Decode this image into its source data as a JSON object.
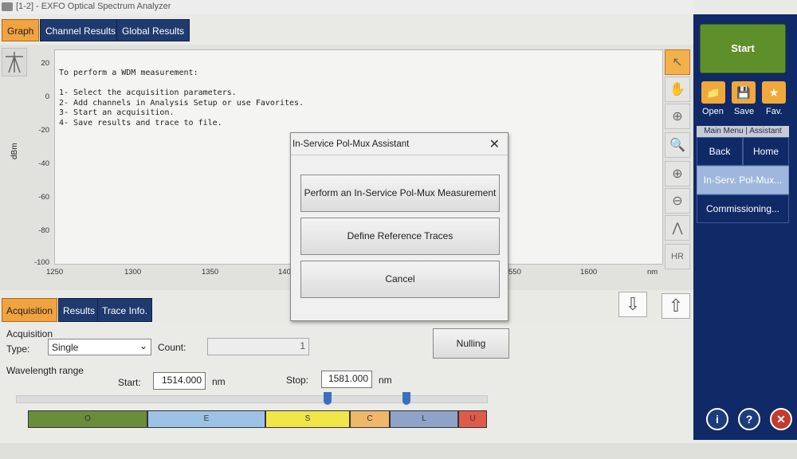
{
  "window": {
    "title": "[1-2] - EXFO Optical Spectrum Analyzer"
  },
  "top_tabs": [
    {
      "label": "Graph",
      "active": true
    },
    {
      "label": "Channel Results",
      "active": false
    },
    {
      "label": "Global Results",
      "active": false
    }
  ],
  "graph": {
    "ylabel": "dBm",
    "xunit": "nm",
    "yticks": [
      "20",
      "0",
      "-20",
      "-40",
      "-60",
      "-80",
      "-100"
    ],
    "xticks": [
      "1250",
      "1300",
      "1350",
      "140",
      "550",
      "1600"
    ],
    "instructions": [
      "To perform a WDM measurement:",
      "",
      "1- Select the acquisition parameters.",
      "2- Add channels in Analysis Setup or use Favorites.",
      "3- Start an acquisition.",
      "4- Save results and trace to file."
    ]
  },
  "graph_tools": [
    {
      "icon": "pointer-icon",
      "selected": true
    },
    {
      "icon": "hand-icon"
    },
    {
      "icon": "zoom-fit-icon"
    },
    {
      "icon": "zoom-one-icon"
    },
    {
      "icon": "zoom-in-icon"
    },
    {
      "icon": "zoom-out-icon"
    },
    {
      "icon": "marker-range-icon"
    },
    {
      "label": "HR"
    }
  ],
  "bottom_tabs": [
    {
      "label": "Acquisition",
      "active": true
    },
    {
      "label": "Results",
      "active": false
    },
    {
      "label": "Trace Info.",
      "active": false
    }
  ],
  "acquisition": {
    "section": "Acquisition",
    "type_label": "Type:",
    "type_value": "Single",
    "count_label": "Count:",
    "count_value": "1",
    "nulling_label": "Nulling",
    "wavelength_label": "Wavelength range",
    "start_label": "Start:",
    "start_value": "1514.000",
    "stop_label": "Stop:",
    "stop_value": "1581.000",
    "unit": "nm",
    "bands": [
      {
        "label": "O",
        "color": "#6a8d3a"
      },
      {
        "label": "E",
        "color": "#9cc3e6"
      },
      {
        "label": "S",
        "color": "#f0e64a"
      },
      {
        "label": "C",
        "color": "#f0b66a"
      },
      {
        "label": "L",
        "color": "#8fa3c8"
      },
      {
        "label": "U",
        "color": "#e05a4a"
      }
    ]
  },
  "right_panel": {
    "start_label": "Start",
    "open_label": "Open",
    "save_label": "Save",
    "fav_label": "Fav.",
    "menu_tabs": "Main Menu | Assistant",
    "back_label": "Back",
    "home_label": "Home",
    "inservice_label": "In-Serv. Pol-Mux...",
    "commissioning_label": "Commissioning...",
    "accent": "#0f2a66"
  },
  "dialog": {
    "title": "In-Service Pol-Mux Assistant",
    "close": "✕",
    "buttons": [
      "Perform an In-Service Pol-Mux Measurement",
      "Define Reference Traces",
      "Cancel"
    ]
  }
}
